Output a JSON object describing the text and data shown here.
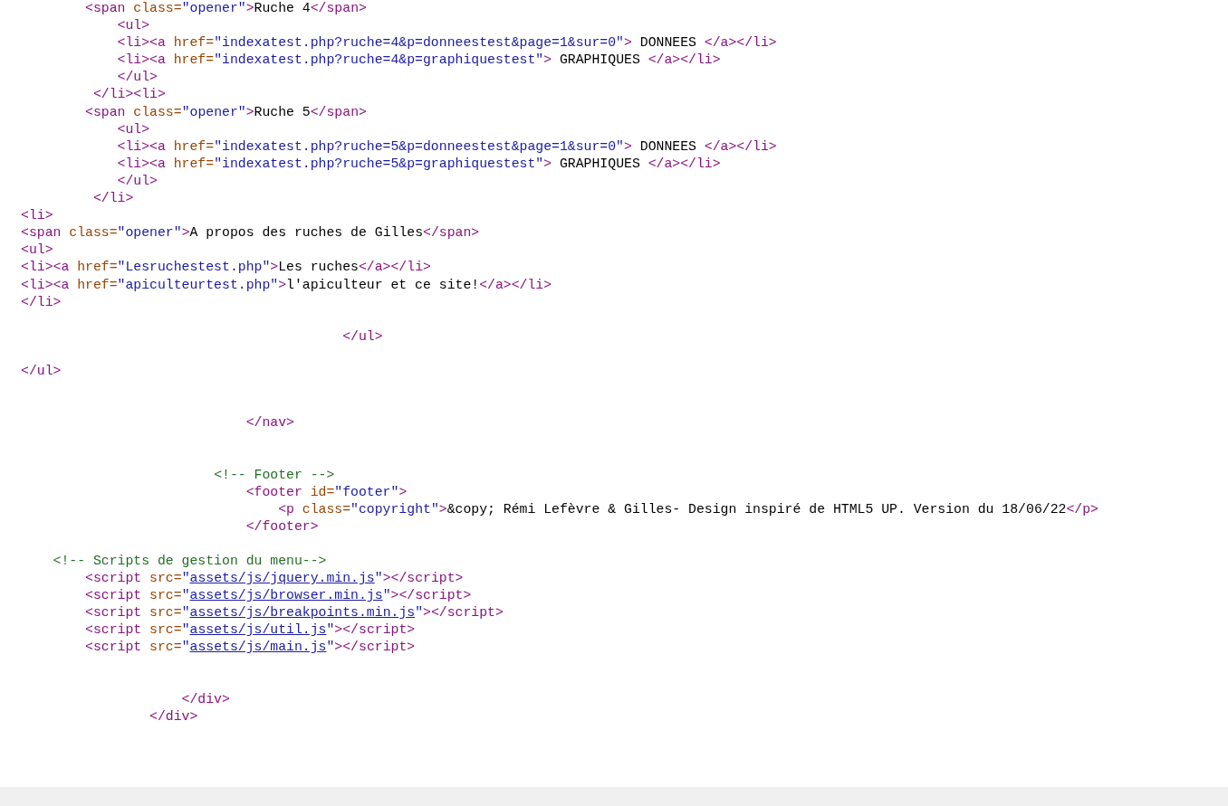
{
  "source_lines": [
    {
      "kind": "code",
      "tokens": [
        {
          "kind": "tag",
          "text": "        <span"
        },
        {
          "kind": "attr",
          "text": " class="
        },
        {
          "kind": "value",
          "text": "\"opener\""
        },
        {
          "kind": "tag",
          "text": ">"
        },
        {
          "kind": "text",
          "text": "Ruche 4"
        },
        {
          "kind": "tag",
          "text": "</span>"
        }
      ]
    },
    {
      "kind": "code",
      "tokens": [
        {
          "kind": "tag",
          "text": "            <ul>"
        }
      ]
    },
    {
      "kind": "code",
      "tokens": [
        {
          "kind": "tag",
          "text": "            <li><a"
        },
        {
          "kind": "attr",
          "text": " href="
        },
        {
          "kind": "value",
          "text": "\"indexatest.php?ruche=4&p=donneestest&page=1&sur=0\""
        },
        {
          "kind": "tag",
          "text": ">"
        },
        {
          "kind": "text",
          "text": " DONNEES "
        },
        {
          "kind": "tag",
          "text": "</a></li>"
        }
      ]
    },
    {
      "kind": "code",
      "tokens": [
        {
          "kind": "tag",
          "text": "            <li><a"
        },
        {
          "kind": "attr",
          "text": " href="
        },
        {
          "kind": "value",
          "text": "\"indexatest.php?ruche=4&p=graphiquestest\""
        },
        {
          "kind": "tag",
          "text": ">"
        },
        {
          "kind": "text",
          "text": " GRAPHIQUES "
        },
        {
          "kind": "tag",
          "text": "</a></li>"
        }
      ]
    },
    {
      "kind": "code",
      "tokens": [
        {
          "kind": "tag",
          "text": "            </ul>"
        }
      ]
    },
    {
      "kind": "code",
      "tokens": [
        {
          "kind": "tag",
          "text": "         </li><li>"
        }
      ]
    },
    {
      "kind": "code",
      "tokens": [
        {
          "kind": "tag",
          "text": "        <span"
        },
        {
          "kind": "attr",
          "text": " class="
        },
        {
          "kind": "value",
          "text": "\"opener\""
        },
        {
          "kind": "tag",
          "text": ">"
        },
        {
          "kind": "text",
          "text": "Ruche 5"
        },
        {
          "kind": "tag",
          "text": "</span>"
        }
      ]
    },
    {
      "kind": "code",
      "tokens": [
        {
          "kind": "tag",
          "text": "            <ul>"
        }
      ]
    },
    {
      "kind": "code",
      "tokens": [
        {
          "kind": "tag",
          "text": "            <li><a"
        },
        {
          "kind": "attr",
          "text": " href="
        },
        {
          "kind": "value",
          "text": "\"indexatest.php?ruche=5&p=donneestest&page=1&sur=0\""
        },
        {
          "kind": "tag",
          "text": ">"
        },
        {
          "kind": "text",
          "text": " DONNEES "
        },
        {
          "kind": "tag",
          "text": "</a></li>"
        }
      ]
    },
    {
      "kind": "code",
      "tokens": [
        {
          "kind": "tag",
          "text": "            <li><a"
        },
        {
          "kind": "attr",
          "text": " href="
        },
        {
          "kind": "value",
          "text": "\"indexatest.php?ruche=5&p=graphiquestest\""
        },
        {
          "kind": "tag",
          "text": ">"
        },
        {
          "kind": "text",
          "text": " GRAPHIQUES "
        },
        {
          "kind": "tag",
          "text": "</a></li>"
        }
      ]
    },
    {
      "kind": "code",
      "tokens": [
        {
          "kind": "tag",
          "text": "            </ul>"
        }
      ]
    },
    {
      "kind": "code",
      "tokens": [
        {
          "kind": "tag",
          "text": "         </li>"
        }
      ]
    },
    {
      "kind": "code",
      "tokens": [
        {
          "kind": "tag",
          "text": "<li>"
        }
      ]
    },
    {
      "kind": "code",
      "tokens": [
        {
          "kind": "tag",
          "text": "<span"
        },
        {
          "kind": "attr",
          "text": " class="
        },
        {
          "kind": "value",
          "text": "\"opener\""
        },
        {
          "kind": "tag",
          "text": ">"
        },
        {
          "kind": "text",
          "text": "A propos des ruches de Gilles"
        },
        {
          "kind": "tag",
          "text": "</span>"
        }
      ]
    },
    {
      "kind": "code",
      "tokens": [
        {
          "kind": "tag",
          "text": "<ul>"
        }
      ]
    },
    {
      "kind": "code",
      "tokens": [
        {
          "kind": "tag",
          "text": "<li><a"
        },
        {
          "kind": "attr",
          "text": " href="
        },
        {
          "kind": "value",
          "text": "\"Lesruchestest.php\""
        },
        {
          "kind": "tag",
          "text": ">"
        },
        {
          "kind": "text",
          "text": "Les ruches"
        },
        {
          "kind": "tag",
          "text": "</a></li>"
        }
      ]
    },
    {
      "kind": "code",
      "tokens": [
        {
          "kind": "tag",
          "text": "<li><a"
        },
        {
          "kind": "attr",
          "text": " href="
        },
        {
          "kind": "value",
          "text": "\"apiculteurtest.php\""
        },
        {
          "kind": "tag",
          "text": ">"
        },
        {
          "kind": "text",
          "text": "l'apiculteur et ce site!"
        },
        {
          "kind": "tag",
          "text": "</a></li>"
        }
      ]
    },
    {
      "kind": "code",
      "tokens": [
        {
          "kind": "tag",
          "text": "</li>"
        }
      ]
    },
    {
      "kind": "blank"
    },
    {
      "kind": "code",
      "tokens": [
        {
          "kind": "tag",
          "text": "                                        </ul>"
        }
      ]
    },
    {
      "kind": "blank"
    },
    {
      "kind": "code",
      "tokens": [
        {
          "kind": "tag",
          "text": "</ul>"
        }
      ]
    },
    {
      "kind": "blank"
    },
    {
      "kind": "blank"
    },
    {
      "kind": "code",
      "tokens": [
        {
          "kind": "tag",
          "text": "                            </nav>"
        }
      ]
    },
    {
      "kind": "blank"
    },
    {
      "kind": "blank"
    },
    {
      "kind": "code",
      "tokens": [
        {
          "kind": "comment",
          "text": "                        <!-- Footer -->"
        }
      ]
    },
    {
      "kind": "code",
      "tokens": [
        {
          "kind": "tag",
          "text": "                            <footer"
        },
        {
          "kind": "attr",
          "text": " id="
        },
        {
          "kind": "value",
          "text": "\"footer\""
        },
        {
          "kind": "tag",
          "text": ">"
        }
      ]
    },
    {
      "kind": "code",
      "tokens": [
        {
          "kind": "tag",
          "text": "                                <p"
        },
        {
          "kind": "attr",
          "text": " class="
        },
        {
          "kind": "value",
          "text": "\"copyright\""
        },
        {
          "kind": "tag",
          "text": ">"
        },
        {
          "kind": "text",
          "text": "&copy; Rémi Lefèvre & Gilles- Design inspiré de HTML5 UP. Version du 18/06/22"
        },
        {
          "kind": "tag",
          "text": "</p>"
        }
      ]
    },
    {
      "kind": "code",
      "tokens": [
        {
          "kind": "tag",
          "text": "                            </footer>"
        }
      ]
    },
    {
      "kind": "blank"
    },
    {
      "kind": "code",
      "tokens": [
        {
          "kind": "comment",
          "text": "    <!-- Scripts de gestion du menu-->"
        }
      ]
    },
    {
      "kind": "code",
      "tokens": [
        {
          "kind": "tag",
          "text": "        <script"
        },
        {
          "kind": "attr",
          "text": " src="
        },
        {
          "kind": "value",
          "text": "\""
        },
        {
          "kind": "link",
          "text": "assets/js/jquery.min.js"
        },
        {
          "kind": "value",
          "text": "\""
        },
        {
          "kind": "tag",
          "text": "></script>"
        }
      ]
    },
    {
      "kind": "code",
      "tokens": [
        {
          "kind": "tag",
          "text": "        <script"
        },
        {
          "kind": "attr",
          "text": " src="
        },
        {
          "kind": "value",
          "text": "\""
        },
        {
          "kind": "link",
          "text": "assets/js/browser.min.js"
        },
        {
          "kind": "value",
          "text": "\""
        },
        {
          "kind": "tag",
          "text": "></script>"
        }
      ]
    },
    {
      "kind": "code",
      "tokens": [
        {
          "kind": "tag",
          "text": "        <script"
        },
        {
          "kind": "attr",
          "text": " src="
        },
        {
          "kind": "value",
          "text": "\""
        },
        {
          "kind": "link",
          "text": "assets/js/breakpoints.min.js"
        },
        {
          "kind": "value",
          "text": "\""
        },
        {
          "kind": "tag",
          "text": "></script>"
        }
      ]
    },
    {
      "kind": "code",
      "tokens": [
        {
          "kind": "tag",
          "text": "        <script"
        },
        {
          "kind": "attr",
          "text": " src="
        },
        {
          "kind": "value",
          "text": "\""
        },
        {
          "kind": "link",
          "text": "assets/js/util.js"
        },
        {
          "kind": "value",
          "text": "\""
        },
        {
          "kind": "tag",
          "text": "></script>"
        }
      ]
    },
    {
      "kind": "code",
      "tokens": [
        {
          "kind": "tag",
          "text": "        <script"
        },
        {
          "kind": "attr",
          "text": " src="
        },
        {
          "kind": "value",
          "text": "\""
        },
        {
          "kind": "link",
          "text": "assets/js/main.js"
        },
        {
          "kind": "value",
          "text": "\""
        },
        {
          "kind": "tag",
          "text": "></script>"
        }
      ]
    },
    {
      "kind": "blank"
    },
    {
      "kind": "blank"
    },
    {
      "kind": "code",
      "tokens": [
        {
          "kind": "tag",
          "text": "                    </div>"
        }
      ]
    },
    {
      "kind": "code",
      "tokens": [
        {
          "kind": "tag",
          "text": "                </div>"
        }
      ]
    }
  ]
}
